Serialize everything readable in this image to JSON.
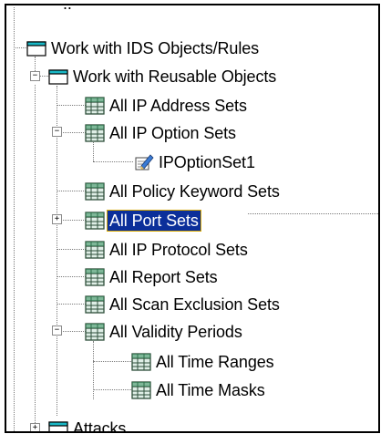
{
  "tree": {
    "clipped_header": "..  -",
    "root_label": "Work with IDS Objects/Rules",
    "reusable_label": "Work with Reusable Objects",
    "items": {
      "ip_address_sets": "All IP Address Sets",
      "ip_option_sets": "All IP Option Sets",
      "ip_option_set1": "IPOptionSet1",
      "policy_keyword_sets": "All Policy Keyword Sets",
      "port_sets": "All Port Sets",
      "ip_protocol_sets": "All IP Protocol Sets",
      "report_sets": "All Report Sets",
      "scan_exclusion_sets": "All Scan Exclusion Sets",
      "validity_periods": "All Validity Periods",
      "time_ranges": "All Time Ranges",
      "time_masks": "All Time Masks"
    },
    "attacks_label": "Attacks"
  },
  "icons": {
    "folder": "folder-icon",
    "table": "table-icon",
    "item": "pencil-document-icon"
  },
  "colors": {
    "selection_bg": "#0b2f9a",
    "selection_outline": "#d8a900",
    "folder_cyan": "#19b8c6",
    "table_green": "#2e8b57"
  }
}
